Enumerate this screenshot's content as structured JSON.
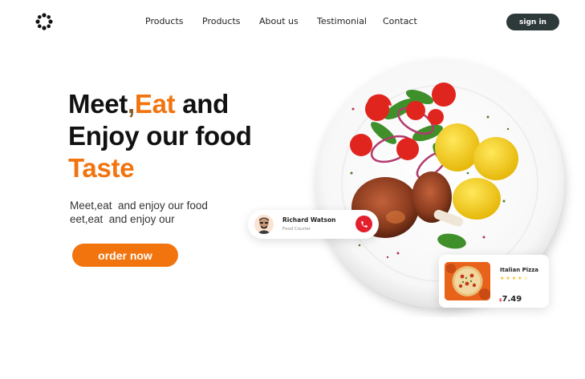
{
  "header": {
    "nav_items": [
      "Products",
      "Products",
      "About us",
      "Testimonial",
      "Contact"
    ],
    "signin_label": "sign in"
  },
  "hero": {
    "headline": {
      "w1": "Meet",
      "comma": ",",
      "w2": "Eat",
      "w3": " and",
      "line2": "Enjoy our food",
      "line3": "Taste"
    },
    "subtext_line1": "Meet,eat  and enjoy our food",
    "subtext_line2": "eet,eat  and enjoy our",
    "cta_label": "order now"
  },
  "courier": {
    "name": "Richard Watson",
    "role": "Food Courier"
  },
  "pizza": {
    "name": "Italian Pizza",
    "stars": "★★★★☆",
    "rating": 4,
    "currency": "$",
    "price": "7.49"
  },
  "colors": {
    "accent": "#f2740f",
    "dark_button": "#2e3a3a",
    "call_red": "#e4202e",
    "star": "#f5b91a"
  },
  "icons": [
    "logo-icon",
    "phone-icon",
    "avatar",
    "plate-image",
    "pizza-image"
  ]
}
